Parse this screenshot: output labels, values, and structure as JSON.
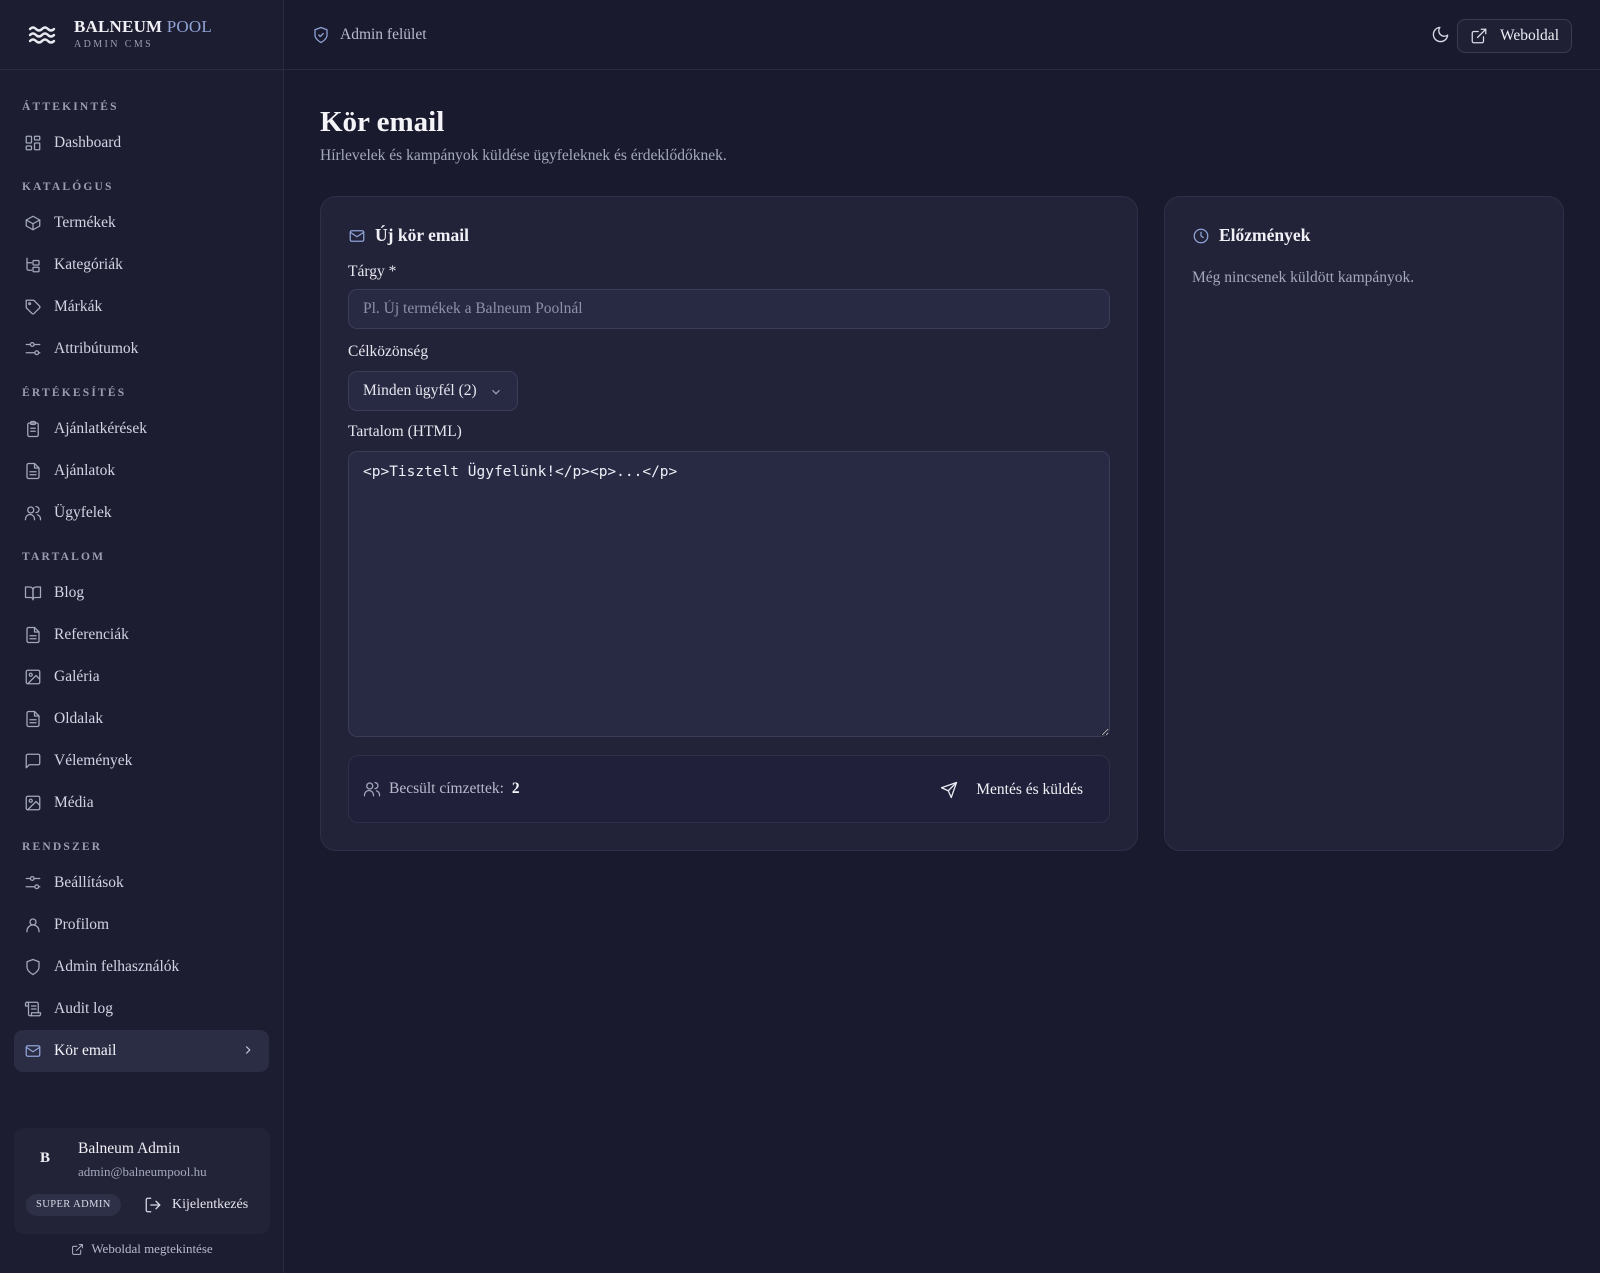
{
  "brand": {
    "name_main": "BALNEUM",
    "name_accent": "POOL",
    "subtitle": "ADMIN CMS"
  },
  "sidebar": {
    "sections": [
      {
        "title": "ÁTTEKINTÉS",
        "items": [
          {
            "label": "Dashboard",
            "icon": "grid-icon"
          }
        ]
      },
      {
        "title": "KATALÓGUS",
        "items": [
          {
            "label": "Termékek",
            "icon": "box-icon"
          },
          {
            "label": "Kategóriák",
            "icon": "tree-icon"
          },
          {
            "label": "Márkák",
            "icon": "tag-icon"
          },
          {
            "label": "Attribútumok",
            "icon": "sliders-icon"
          }
        ]
      },
      {
        "title": "ÉRTÉKESÍTÉS",
        "items": [
          {
            "label": "Ajánlatkérések",
            "icon": "clipboard-icon"
          },
          {
            "label": "Ajánlatok",
            "icon": "file-icon"
          },
          {
            "label": "Ügyfelek",
            "icon": "users-icon"
          }
        ]
      },
      {
        "title": "TARTALOM",
        "items": [
          {
            "label": "Blog",
            "icon": "book-icon"
          },
          {
            "label": "Referenciák",
            "icon": "file-icon"
          },
          {
            "label": "Galéria",
            "icon": "image-icon"
          },
          {
            "label": "Oldalak",
            "icon": "file-icon"
          },
          {
            "label": "Vélemények",
            "icon": "message-icon"
          },
          {
            "label": "Média",
            "icon": "image-icon"
          }
        ]
      },
      {
        "title": "RENDSZER",
        "items": [
          {
            "label": "Beállítások",
            "icon": "sliders-icon"
          },
          {
            "label": "Profilom",
            "icon": "user-icon"
          },
          {
            "label": "Admin felhasználók",
            "icon": "shield-icon"
          },
          {
            "label": "Audit log",
            "icon": "scroll-icon"
          },
          {
            "label": "Kör email",
            "icon": "mail-icon",
            "active": true
          }
        ]
      }
    ],
    "user": {
      "initial": "B",
      "name": "Balneum Admin",
      "email": "admin@balneumpool.hu",
      "role": "SUPER ADMIN",
      "logout_label": "Kijelentkezés"
    },
    "view_site_label": "Weboldal megtekintése"
  },
  "topbar": {
    "crumb": "Admin felület",
    "site_button": "Weboldal"
  },
  "page": {
    "title": "Kör email",
    "subtitle": "Hírlevelek és kampányok küldése ügyfeleknek és érdeklődőknek."
  },
  "form": {
    "heading": "Új kör email",
    "subject_label": "Tárgy *",
    "subject_placeholder": "Pl. Új termékek a Balneum Poolnál",
    "audience_label": "Célközönség",
    "audience_value": "Minden ügyfél (2)",
    "content_label": "Tartalom (HTML)",
    "content_value": "<p>Tisztelt Ügyfelünk!</p><p>...</p>",
    "recipients_label": "Becsült címzettek:",
    "recipients_count": "2",
    "send_label": "Mentés és küldés"
  },
  "history": {
    "heading": "Előzmények",
    "empty": "Még nincsenek küldött kampányok."
  },
  "colors": {
    "accent": "#8fa3d6",
    "background": "#1a1a2e",
    "card": "#222238"
  }
}
